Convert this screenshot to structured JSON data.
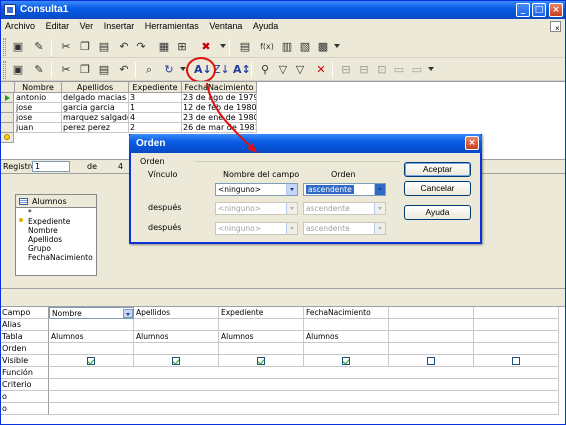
{
  "window": {
    "title": "Consulta1"
  },
  "menu": [
    "Archivo",
    "Editar",
    "Ver",
    "Insertar",
    "Herramientas",
    "Ventana",
    "Ayuda"
  ],
  "icons": [
    "save-icon",
    "edit-icon",
    "cut-icon",
    "copy-icon",
    "paste-icon",
    "undo-icon",
    "redo-icon",
    "sort-ascending-icon",
    "sort-descending-icon",
    "filter-icon",
    "find-icon"
  ],
  "datagrid": {
    "columns": [
      "Nombre",
      "Apellidos",
      "Expediente",
      "FechaNacimiento"
    ],
    "rows": [
      [
        "antonio",
        "delgado macias",
        "3",
        "23 de ago de 1979"
      ],
      [
        "jose",
        "garcia garcia",
        "1",
        "12 de feb de 1980"
      ],
      [
        "jose",
        "marquez salgado",
        "4",
        "23 de ene de 1980"
      ],
      [
        "juan",
        "perez perez",
        "2",
        "26 de mar de 1981"
      ]
    ]
  },
  "navigation": {
    "label": "Registro",
    "current": "1",
    "of_label": "de",
    "total": "4"
  },
  "table_box": {
    "title": "Alumnos",
    "fields": [
      "*",
      "Expediente",
      "Nombre",
      "Apellidos",
      "Grupo",
      "FechaNacimiento"
    ]
  },
  "query_grid": {
    "row_labels": [
      "Campo",
      "Alias",
      "Tabla",
      "Orden",
      "Visible",
      "Función",
      "Criterio",
      "o",
      "o"
    ],
    "fields": [
      "Nombre",
      "Apellidos",
      "Expediente",
      "FechaNacimiento"
    ],
    "tables": [
      "Alumnos",
      "Alumnos",
      "Alumnos",
      "Alumnos"
    ],
    "visible": [
      true,
      true,
      true,
      true,
      false,
      false
    ]
  },
  "dialog": {
    "title": "Orden",
    "group_label": "Orden",
    "col_field": "Nombre del campo",
    "col_order": "Orden",
    "row_labels": [
      "Vínculo",
      "después",
      "después"
    ],
    "field_values": [
      "<ninguno>",
      "<ninguno>",
      "<ninguno>"
    ],
    "order_values": [
      "ascendente",
      "ascendente",
      "ascendente"
    ],
    "buttons": {
      "ok": "Aceptar",
      "cancel": "Cancelar",
      "help": "Ayuda"
    }
  },
  "colors": {
    "xp_blue": "#0a5ce6",
    "annotation_red": "#e01010",
    "check_green": "#21a121"
  }
}
